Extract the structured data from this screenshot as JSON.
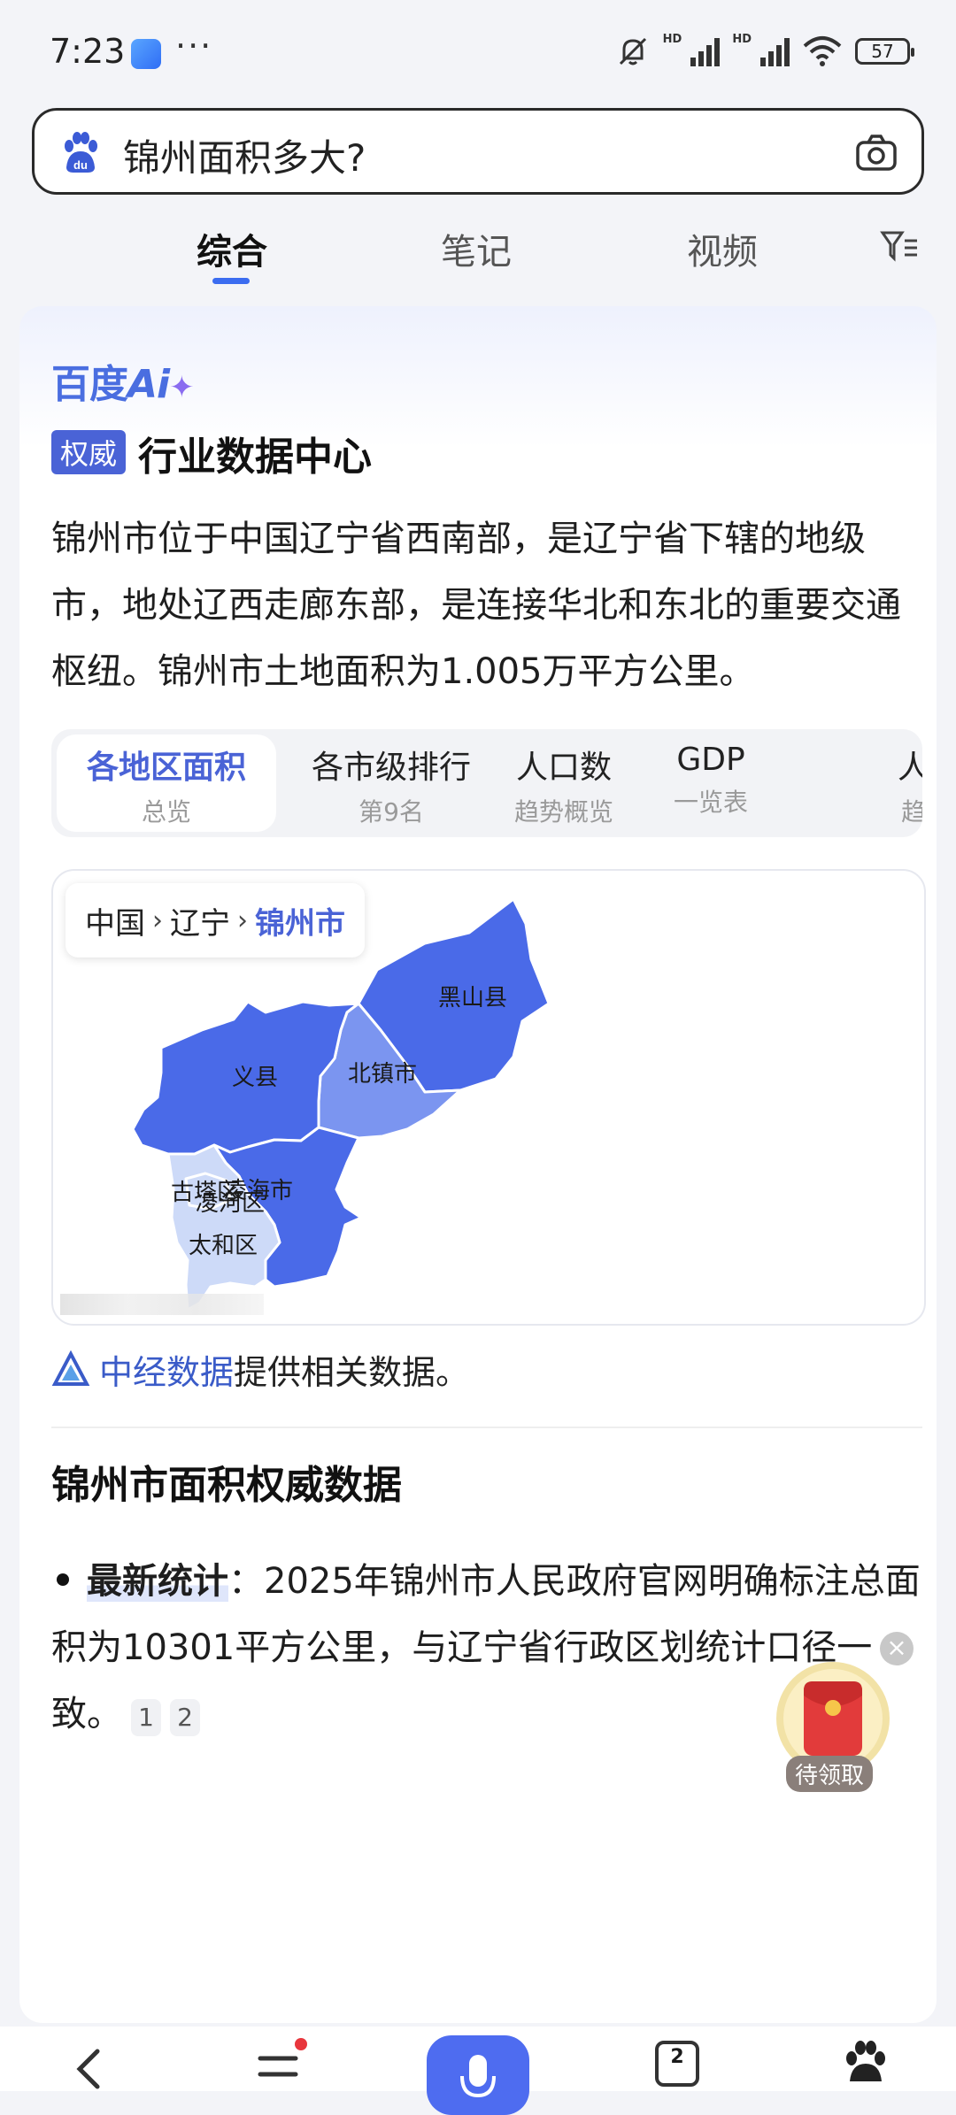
{
  "status_bar": {
    "time": "7:23",
    "dots": "···",
    "battery": "57"
  },
  "search": {
    "query": "锦州面积多大?"
  },
  "tabs": [
    {
      "label": "综合"
    },
    {
      "label": "笔记"
    },
    {
      "label": "视频"
    }
  ],
  "ai_card": {
    "logo_text": "百度",
    "logo_ai": "Ai",
    "logo_spark": "✦",
    "badge": "权威",
    "title": "行业数据中心",
    "summary": "锦州市位于中国辽宁省西南部，是辽宁省下辖的地级市，地处辽西走廊东部，是连接华北和东北的重要交通枢纽。锦州市土地面积为1.005万平方公里。",
    "region_tabs": [
      {
        "title": "各地区面积",
        "sub": "总览"
      },
      {
        "title": "各市级排行",
        "sub": "第9名"
      },
      {
        "title": "人口数",
        "sub": "趋势概览"
      },
      {
        "title": "GDP",
        "sub": "一览表"
      },
      {
        "title": "人",
        "sub": "趋"
      }
    ],
    "breadcrumb": {
      "level1": "中国",
      "level2": "辽宁",
      "current": "锦州市",
      "sep": "›"
    },
    "map_regions": [
      {
        "name": "黑山县"
      },
      {
        "name": "义县"
      },
      {
        "name": "北镇市"
      },
      {
        "name": "凌海市"
      },
      {
        "name": "古塔区"
      },
      {
        "name": "凌河区"
      },
      {
        "name": "太和区"
      }
    ],
    "source_link": "中经数据",
    "source_suffix": "提供相关数据。",
    "section_title": "锦州市面积权威数据",
    "bullet_bold": "最新统计",
    "bullet_text": "：2025年锦州市人民政府官网明确标注总面积为10301平方公里，与辽宁省行政区划统计口径一致。",
    "citations": [
      "1",
      "2"
    ]
  },
  "redpacket": {
    "label": "待领取",
    "close": "×"
  },
  "bottom_nav": {
    "tab_count": "2"
  },
  "colors": {
    "accent": "#4a63d6",
    "map_dark": "#4a6ae8",
    "map_mid": "#7b95f0",
    "map_light": "#cddaf8"
  }
}
